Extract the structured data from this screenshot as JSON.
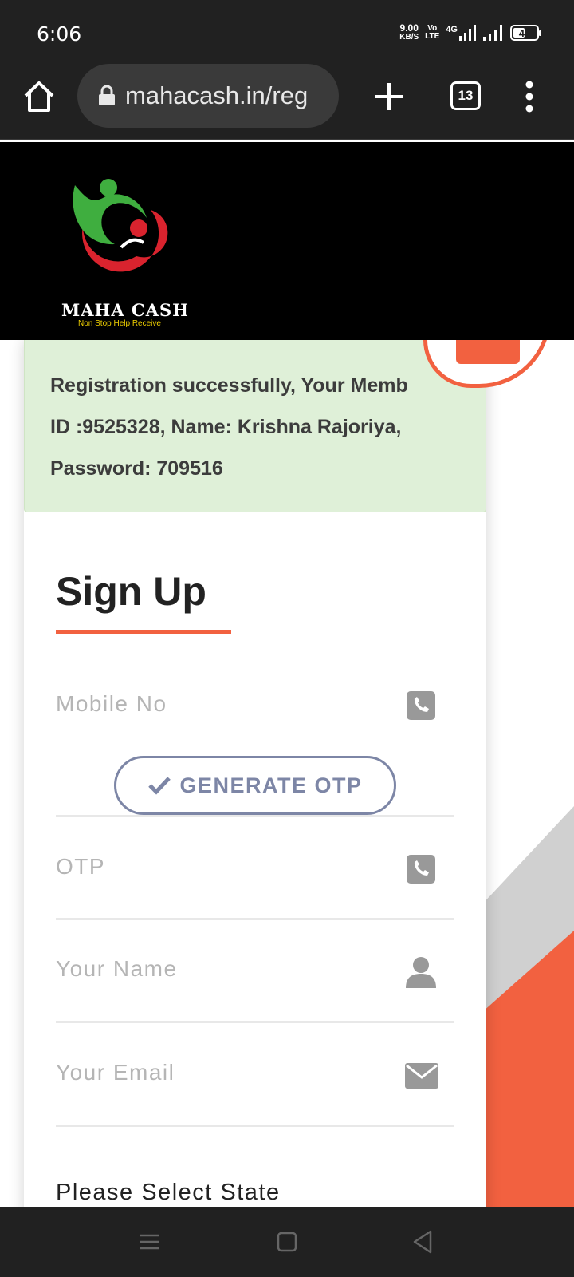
{
  "status_bar": {
    "time": "6:06",
    "net_speed_value": "9.00",
    "net_speed_unit": "KB/S",
    "volte_top": "Vo",
    "volte_bottom": "LTE",
    "network": "4G",
    "battery": "47"
  },
  "browser": {
    "url": "mahacash.in/reg",
    "tab_count": "13"
  },
  "header": {
    "logo_name": "MAHA CASH",
    "logo_tagline": "Non Stop Help Receive"
  },
  "alert": {
    "line1": "Registration successfully, Your Memb",
    "line2": "ID :9525328, Name: Krishna Rajoriya,",
    "line3": "Password: 709516"
  },
  "form": {
    "title": "Sign Up",
    "mobile_placeholder": "Mobile No",
    "generate_otp_label": "GENERATE OTP",
    "otp_placeholder": "OTP",
    "name_placeholder": "Your Name",
    "email_placeholder": "Your Email",
    "state_label": "Please Select State"
  },
  "colors": {
    "accent": "#f26140",
    "button_outline": "#7d86a6",
    "alert_bg": "#dff0d8",
    "header_bg": "#000000"
  },
  "icons": {
    "home": "home-icon",
    "lock": "lock-icon",
    "plus": "plus-icon",
    "menu": "kebab-menu-icon",
    "phone": "phone-icon",
    "user": "user-icon",
    "mail": "envelope-icon",
    "check": "check-icon"
  }
}
